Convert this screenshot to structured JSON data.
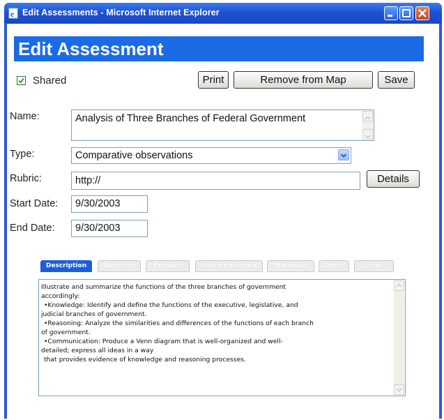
{
  "window": {
    "title": "Edit Assessments - Microsoft Internet Explorer"
  },
  "header": {
    "title": "Edit Assessment"
  },
  "shared": {
    "label": "Shared",
    "checked": true
  },
  "toolbar": {
    "print_label": "Print",
    "remove_label": "Remove from Map",
    "save_label": "Save"
  },
  "form": {
    "name_label": "Name:",
    "name_value": "Analysis of Three Branches of Federal Government",
    "type_label": "Type:",
    "type_value": "Comparative observations",
    "rubric_label": "Rubric:",
    "rubric_value": "http://",
    "details_label": "Details",
    "start_label": "Start Date:",
    "start_value": "9/30/2003",
    "end_label": "End Date:",
    "end_value": "9/30/2003"
  },
  "tabs": [
    {
      "label": "Description",
      "active": true
    },
    {
      "label": "Direction",
      "active": false
    },
    {
      "label": "Product",
      "active": false
    },
    {
      "label": "Scoring Criteria",
      "active": false
    },
    {
      "label": "Materials",
      "active": false
    },
    {
      "label": "Other",
      "active": false
    },
    {
      "label": "Links",
      "active": false
    }
  ],
  "description": {
    "lines": [
      "Illustrate and summarize the functions of the three branches of government",
      "accordingly:",
      "•Knowledge: Identify and define the functions of the executive, legislative, and",
      "judicial branches of government.",
      "•Reasoning: Analyze the similarities and differences of the functions of each branch",
      "of government.",
      "•Communication: Produce a Venn diagram that is well-organized and well-",
      "detailed; express all ideas in a way",
      "that provides evidence of knowledge and reasoning processes."
    ]
  },
  "colors": {
    "banner": "#1b6be6",
    "titlebar": "#1f52d0",
    "active_tab": "#1b5fd8"
  }
}
